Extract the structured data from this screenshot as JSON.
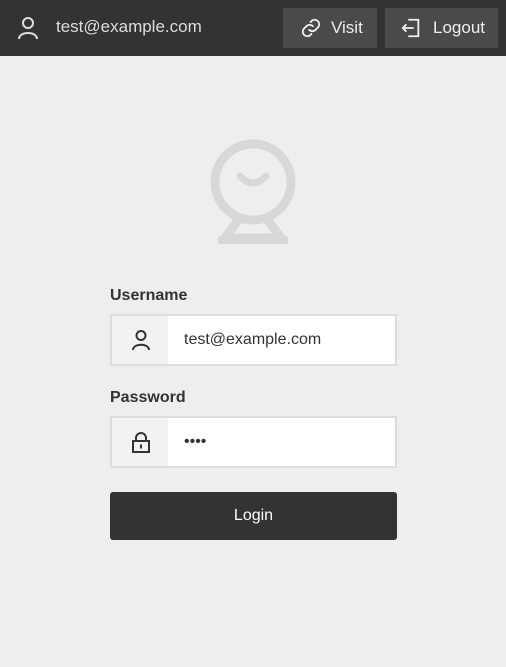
{
  "header": {
    "user_icon": "user-icon",
    "user_email": "test@example.com",
    "visit_icon": "link-icon",
    "visit_label": "Visit",
    "logout_icon": "logout-icon",
    "logout_label": "Logout"
  },
  "logo": {
    "icon": "keyhole-smile-logo"
  },
  "form": {
    "username_label": "Username",
    "username_icon": "user-icon",
    "username_value": "test@example.com",
    "password_label": "Password",
    "password_icon": "lock-icon",
    "password_value": "test",
    "login_label": "Login"
  },
  "colors": {
    "topbar": "#333333",
    "topbar_button": "#4a4a4a",
    "background": "#eeeeee",
    "logo": "#d8d8d8",
    "login_button": "#333333"
  }
}
